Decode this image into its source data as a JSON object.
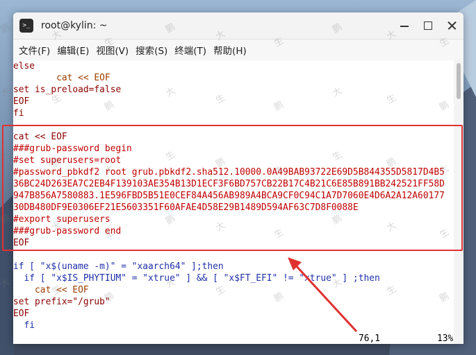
{
  "window": {
    "title": "root@kylin: ~",
    "icon": "terminal-icon"
  },
  "menu": {
    "items": [
      "文件(F)",
      "编辑(E)",
      "视图(V)",
      "搜索(S)",
      "终端(T)",
      "帮助(H)"
    ]
  },
  "editor": {
    "lines": [
      "else",
      "        cat << EOF",
      "set is_preload=false",
      "EOF",
      "fi",
      "",
      "cat << EOF",
      "###grub-password begin",
      "#set superusers=root",
      "#password_pbkdf2 root grub.pbkdf2.sha512.10000.0A49BAB93722E69D5B844355D5817D4B5",
      "36BC24D263EA7C2EB4F139103AE354B13D1ECF3F6BD757CB22B17C4B21C6E85B891BB242521FF58D",
      "947B856A7580883.1E596FBD5B51E0CEF84A456AB989A4BCA9CF0C94C1A7D7060E4D6A2A12A60177",
      "30DB480DF9E0306EF21E5603351F60AFAE4D58E29B1489D594AF63C7D8F0088E",
      "#export superusers",
      "###grub-password end",
      "EOF",
      "",
      "if [ \"x$(uname -m)\" = \"xaarch64\" ];then",
      "  if [ \"x$IS_PHYTIUM\" = \"xtrue\" ] && [ \"x$FT_EFI\" != \"xtrue\" ] ;then",
      "    cat << EOF",
      "set prefix=\"/grub\"",
      "EOF",
      "  fi"
    ],
    "status_position": "76,1",
    "status_percent": "13%"
  },
  "watermark_text": [
    "鹏",
    "大",
    "生"
  ],
  "colors": {
    "highlight": "#e03131",
    "text_red": "#c00000",
    "text_dark": "#8b0000"
  }
}
